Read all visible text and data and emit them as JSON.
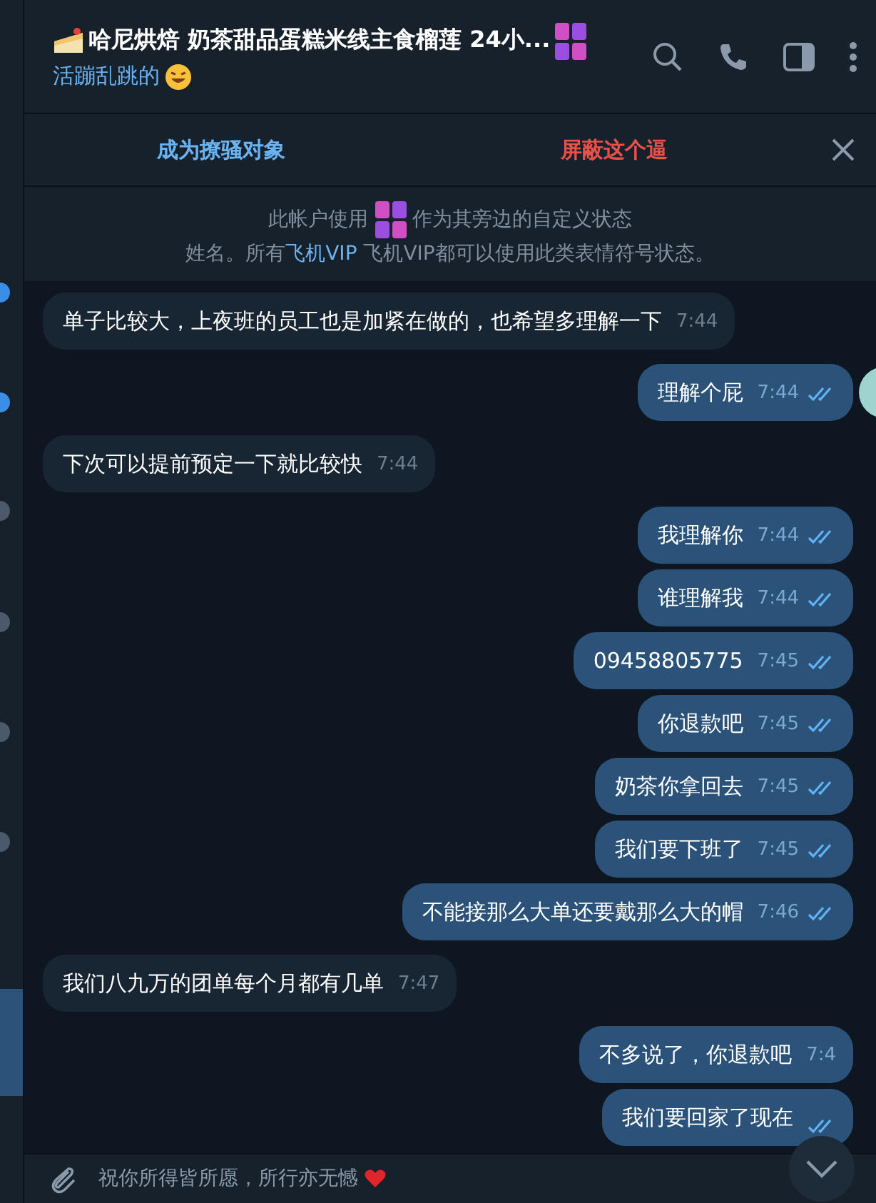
{
  "header": {
    "title": "哈尼烘焙 奶茶甜品蛋糕米线主食榴莲 24小...",
    "status": "活蹦乱跳的"
  },
  "banner": {
    "add_contact": "成为撩骚对象",
    "block": "屏蔽这个逼"
  },
  "note": {
    "line1_before": "此帐户使用",
    "line1_after": "作为其旁边的自定义状态",
    "line2_before": "姓名。所有",
    "link": "飞机VIP",
    "line2_after": " 飞机VIP都可以使用此类表情符号状态。"
  },
  "messages": [
    {
      "text": "单子比较大，上夜班的员工也是加紧在做的，也希望多理解一下",
      "time": "7:44",
      "outgoing": false
    },
    {
      "text": "理解个屁",
      "time": "7:44",
      "outgoing": true,
      "read": true,
      "avatar": true
    },
    {
      "text": "下次可以提前预定一下就比较快",
      "time": "7:44",
      "outgoing": false
    },
    {
      "text": "我理解你",
      "time": "7:44",
      "outgoing": true,
      "read": true
    },
    {
      "text": "谁理解我",
      "time": "7:44",
      "outgoing": true,
      "read": true
    },
    {
      "text": "09458805775",
      "time": "7:45",
      "outgoing": true,
      "read": true
    },
    {
      "text": "你退款吧",
      "time": "7:45",
      "outgoing": true,
      "read": true
    },
    {
      "text": "奶茶你拿回去",
      "time": "7:45",
      "outgoing": true,
      "read": true
    },
    {
      "text": "我们要下班了",
      "time": "7:45",
      "outgoing": true,
      "read": true
    },
    {
      "text": "不能接那么大单还要戴那么大的帽",
      "time": "7:46",
      "outgoing": true,
      "read": true
    },
    {
      "text": "我们八九万的团单每个月都有几单",
      "time": "7:47",
      "outgoing": false
    },
    {
      "text": "不多说了，你退款吧",
      "time": "7:4",
      "outgoing": true
    },
    {
      "text": "我们要回家了现在",
      "outgoing": true,
      "read": true
    }
  ],
  "composer": {
    "draft": "祝你所得皆所愿，所行亦无憾"
  }
}
